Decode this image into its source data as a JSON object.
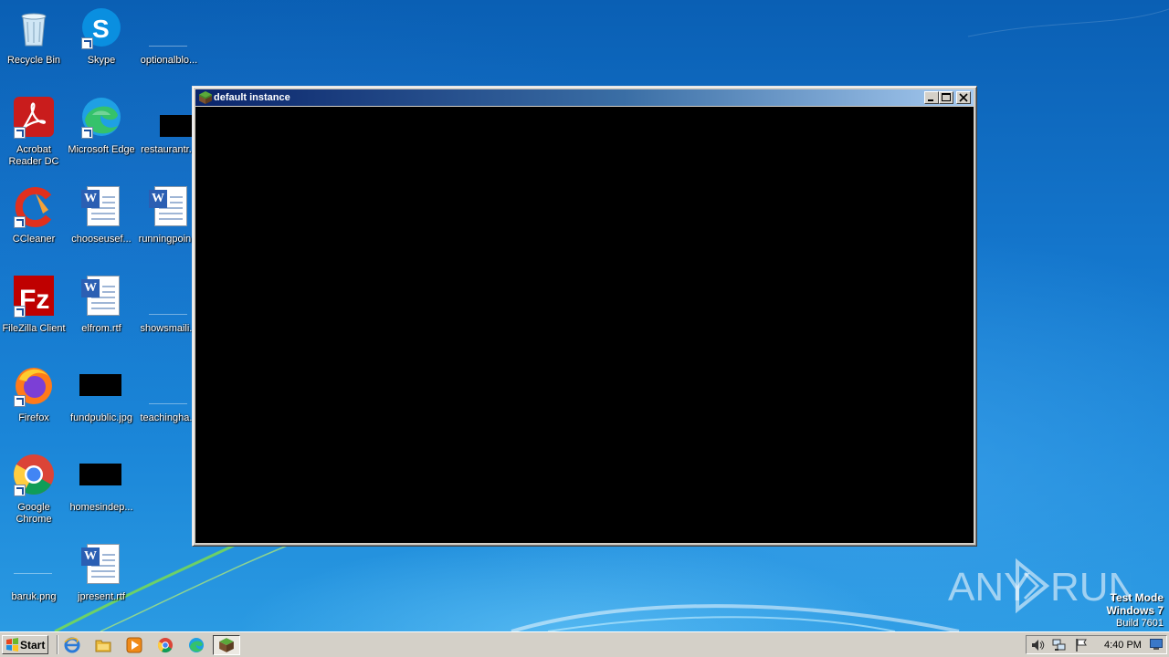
{
  "desktop": {
    "icons": [
      {
        "label": "Recycle Bin",
        "icon": "recycle-bin-icon"
      },
      {
        "label": "Skype",
        "icon": "skype-icon"
      },
      {
        "label": "optionalblo...",
        "icon": "blank-file-icon"
      },
      {
        "label": "Acrobat Reader DC",
        "icon": "acrobat-icon"
      },
      {
        "label": "Microsoft Edge",
        "icon": "edge-icon"
      },
      {
        "label": "restaurantr...",
        "icon": "image-thumb-icon"
      },
      {
        "label": "CCleaner",
        "icon": "ccleaner-icon"
      },
      {
        "label": "chooseusef...",
        "icon": "word-doc-icon"
      },
      {
        "label": "runningpoin...",
        "icon": "word-doc-icon"
      },
      {
        "label": "FileZilla Client",
        "icon": "filezilla-icon"
      },
      {
        "label": "elfrom.rtf",
        "icon": "word-doc-icon"
      },
      {
        "label": "showsmaili...",
        "icon": "blank-file-icon"
      },
      {
        "label": "Firefox",
        "icon": "firefox-icon"
      },
      {
        "label": "fundpublic.jpg",
        "icon": "image-thumb-icon"
      },
      {
        "label": "teachingha...",
        "icon": "blank-file-icon"
      },
      {
        "label": "Google Chrome",
        "icon": "chrome-icon"
      },
      {
        "label": "homesindep...",
        "icon": "image-thumb-icon"
      },
      {
        "label": "baruk.png",
        "icon": "blank-file-icon"
      },
      {
        "label": "jpresent.rtf",
        "icon": "word-doc-icon"
      }
    ]
  },
  "window": {
    "title": "default instance",
    "icon": "minecraft-grass-block-icon"
  },
  "watermark": {
    "brand_left": "ANY",
    "brand_right": "RUN",
    "test_mode": "Test Mode",
    "os": "Windows 7",
    "build": "Build 7601"
  },
  "taskbar": {
    "start_label": "Start",
    "quick_launch": [
      "internet-explorer-icon",
      "explorer-folder-icon",
      "media-player-icon",
      "chrome-icon",
      "edge-icon"
    ],
    "active_task": "minecraft-grass-block-icon",
    "clock": "4:40 PM"
  }
}
